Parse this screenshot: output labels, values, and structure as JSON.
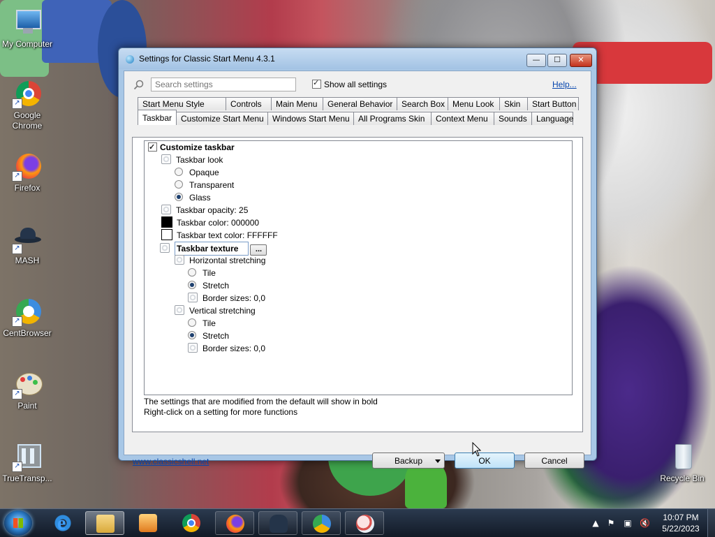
{
  "desktop": {
    "icons": [
      {
        "label": "My Computer"
      },
      {
        "label": "Google Chrome"
      },
      {
        "label": "Firefox"
      },
      {
        "label": "MASH"
      },
      {
        "label": "CentBrowser"
      },
      {
        "label": "Paint"
      },
      {
        "label": "TrueTransp..."
      }
    ],
    "recycle_bin": "Recycle Bin"
  },
  "window": {
    "title": "Settings for Classic Start Menu 4.3.1",
    "controls": {
      "minimize": "—",
      "maximize": "☐",
      "close": "✕"
    },
    "search_placeholder": "Search settings",
    "show_all_label": "Show all settings",
    "help_link": "Help...",
    "tabs_row1": [
      "Start Menu Style",
      "Controls",
      "Main Menu",
      "General Behavior",
      "Search Box",
      "Menu Look",
      "Skin",
      "Start Button"
    ],
    "tabs_row2": [
      "Taskbar",
      "Customize Start Menu",
      "Windows Start Menu",
      "All Programs Skin",
      "Context Menu",
      "Sounds",
      "Language"
    ],
    "active_tab": "Taskbar",
    "tree": {
      "customize_taskbar": "Customize taskbar",
      "taskbar_look": "Taskbar look",
      "opaque": "Opaque",
      "transparent": "Transparent",
      "glass": "Glass",
      "opacity": "Taskbar opacity: 25",
      "color": "Taskbar color: 000000",
      "text_color": "Taskbar text color: FFFFFF",
      "texture": "Taskbar texture",
      "browse": "...",
      "horizontal": "Horizontal stretching",
      "h_tile": "Tile",
      "h_stretch": "Stretch",
      "h_border": "Border sizes: 0,0",
      "vertical": "Vertical stretching",
      "v_tile": "Tile",
      "v_stretch": "Stretch",
      "v_border": "Border sizes: 0,0"
    },
    "hint1": "The settings that are modified from the default will show in bold",
    "hint2": "Right-click on a setting for more functions",
    "website": "www.classicshell.net",
    "backup_label": "Backup",
    "ok_label": "OK",
    "cancel_label": "Cancel"
  },
  "taskbar": {
    "time": "10:07 PM",
    "date": "5/22/2023"
  }
}
